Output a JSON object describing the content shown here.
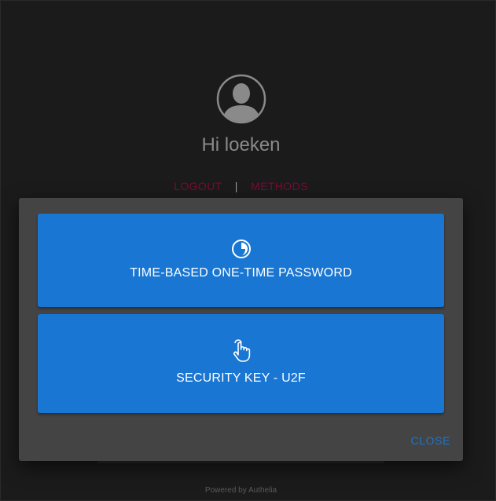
{
  "header": {
    "greeting": "Hi loeken",
    "avatar_icon": "user-avatar-icon"
  },
  "links": {
    "logout": "LOGOUT",
    "separator": "|",
    "methods": "METHODS"
  },
  "dialog": {
    "methods": [
      {
        "label": "TIME-BASED ONE-TIME PASSWORD",
        "icon": "timer-icon"
      },
      {
        "label": "SECURITY KEY - U2F",
        "icon": "touch-hand-icon"
      }
    ],
    "close_label": "CLOSE"
  },
  "footer": {
    "powered_by": "Powered by Authelia"
  },
  "colors": {
    "background": "#1b1b1b",
    "dialog": "#444444",
    "primary": "#1976d2",
    "link": "#7a0b35"
  }
}
